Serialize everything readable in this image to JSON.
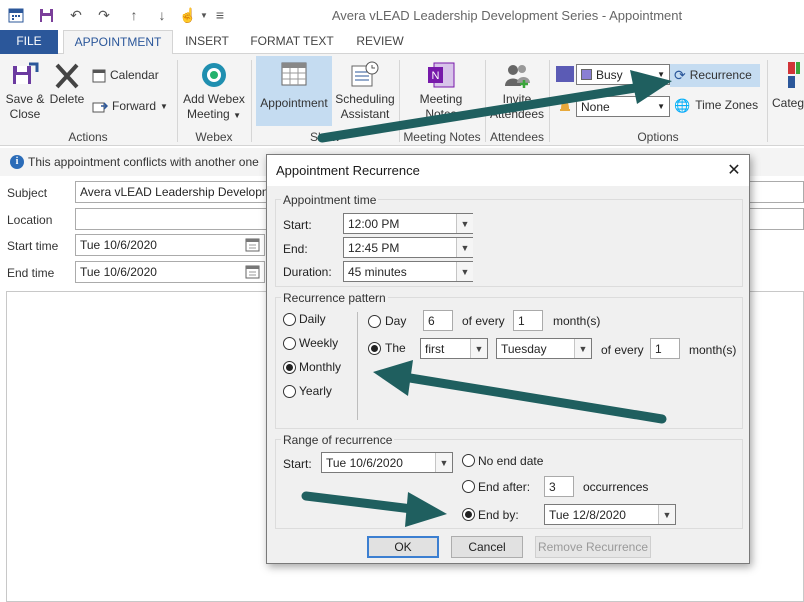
{
  "window": {
    "title": "Avera vLEAD Leadership Development Series - Appointment"
  },
  "tabs": [
    "FILE",
    "APPOINTMENT",
    "INSERT",
    "FORMAT TEXT",
    "REVIEW"
  ],
  "ribbon": {
    "save_close": [
      "Save &",
      "Close"
    ],
    "delete": "Delete",
    "calendar": "Calendar",
    "forward": "Forward",
    "actions_group": "Actions",
    "add_webex": [
      "Add Webex",
      "Meeting"
    ],
    "webex_group": "Webex",
    "appointment": "Appointment",
    "scheduling": [
      "Scheduling",
      "Assistant"
    ],
    "show_group": "Show",
    "meeting_notes": [
      "Meeting",
      "Notes"
    ],
    "meeting_notes_group": "Meeting Notes",
    "invite_attendees": [
      "Invite",
      "Attendees"
    ],
    "attendees_group": "Attendees",
    "show_as": "Busy",
    "reminder": "None",
    "recurrence": "Recurrence",
    "time_zones": "Time Zones",
    "options_group": "Options",
    "categorize": "Categ",
    "show_as_color": "#8a7fd4",
    "reminder_color": "#e7a93b"
  },
  "infobar": {
    "text": "This appointment conflicts with another one"
  },
  "form": {
    "subject_label": "Subject",
    "subject_value": "Avera vLEAD Leadership Development Series",
    "location_label": "Location",
    "start_label": "Start time",
    "start_value": "Tue 10/6/2020",
    "end_label": "End time",
    "end_value": "Tue 10/6/2020"
  },
  "dialog": {
    "title": "Appointment Recurrence",
    "appointment_time": {
      "group_label": "Appointment time",
      "start_label": "Start:",
      "start_value": "12:00 PM",
      "end_label": "End:",
      "end_value": "12:45 PM",
      "duration_label": "Duration:",
      "duration_value": "45 minutes"
    },
    "pattern": {
      "group_label": "Recurrence pattern",
      "daily": "Daily",
      "weekly": "Weekly",
      "monthly": "Monthly",
      "yearly": "Yearly",
      "day_label": "Day",
      "day_value": "6",
      "of_every_1": "of every",
      "months_value_1": "1",
      "months_1": "month(s)",
      "the_label": "The",
      "ordinal": "first",
      "weekday": "Tuesday",
      "of_every_2": "of every",
      "months_value_2": "1",
      "months_2": "month(s)"
    },
    "range": {
      "group_label": "Range of recurrence",
      "start_label": "Start:",
      "start_value": "Tue 10/6/2020",
      "no_end": "No end date",
      "end_after": "End after:",
      "occurrences_value": "3",
      "occurrences": "occurrences",
      "end_by": "End by:",
      "end_by_value": "Tue 12/8/2020"
    },
    "ok": "OK",
    "cancel": "Cancel",
    "remove": "Remove Recurrence"
  },
  "annotation_color": "#1f5f5f"
}
